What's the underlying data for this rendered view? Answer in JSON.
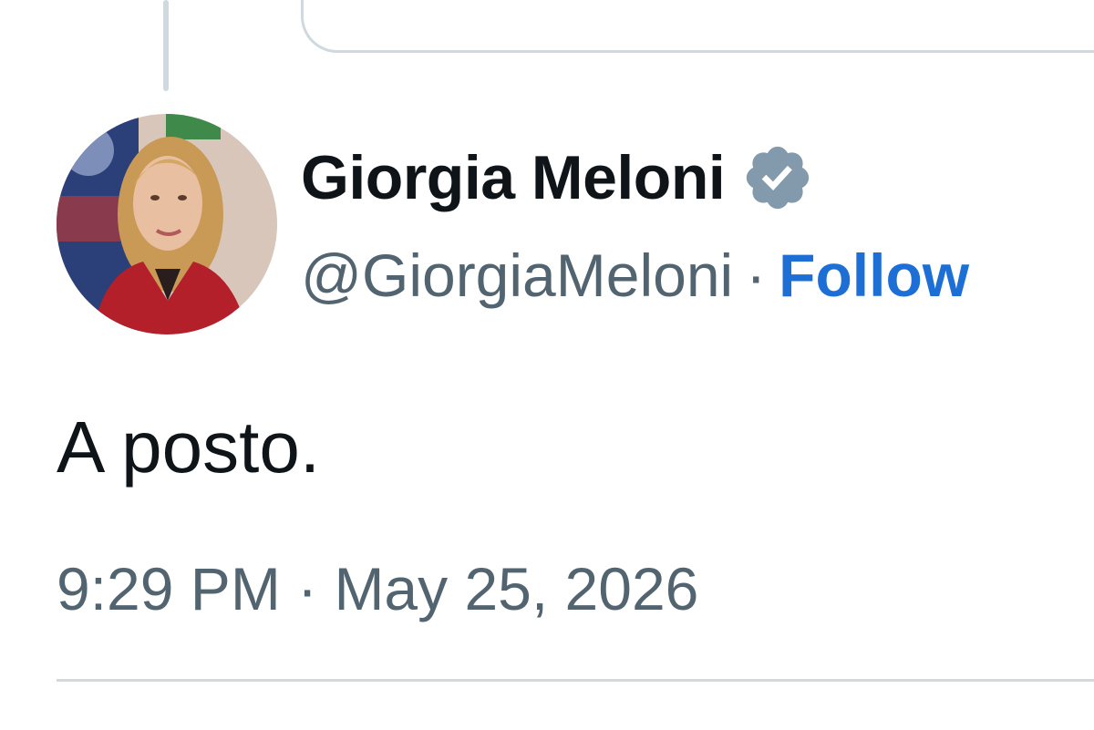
{
  "tweet": {
    "author": {
      "display_name": "Giorgia Meloni",
      "handle": "@GiorgiaMeloni",
      "verified": true,
      "verified_badge_color": "#829aab",
      "avatar_icon": "profile-photo"
    },
    "separator": "·",
    "follow_label": "Follow",
    "follow_color": "#1d6fd6",
    "text": "A posto.",
    "timestamp": "9:29 PM · May 25, 2026"
  }
}
